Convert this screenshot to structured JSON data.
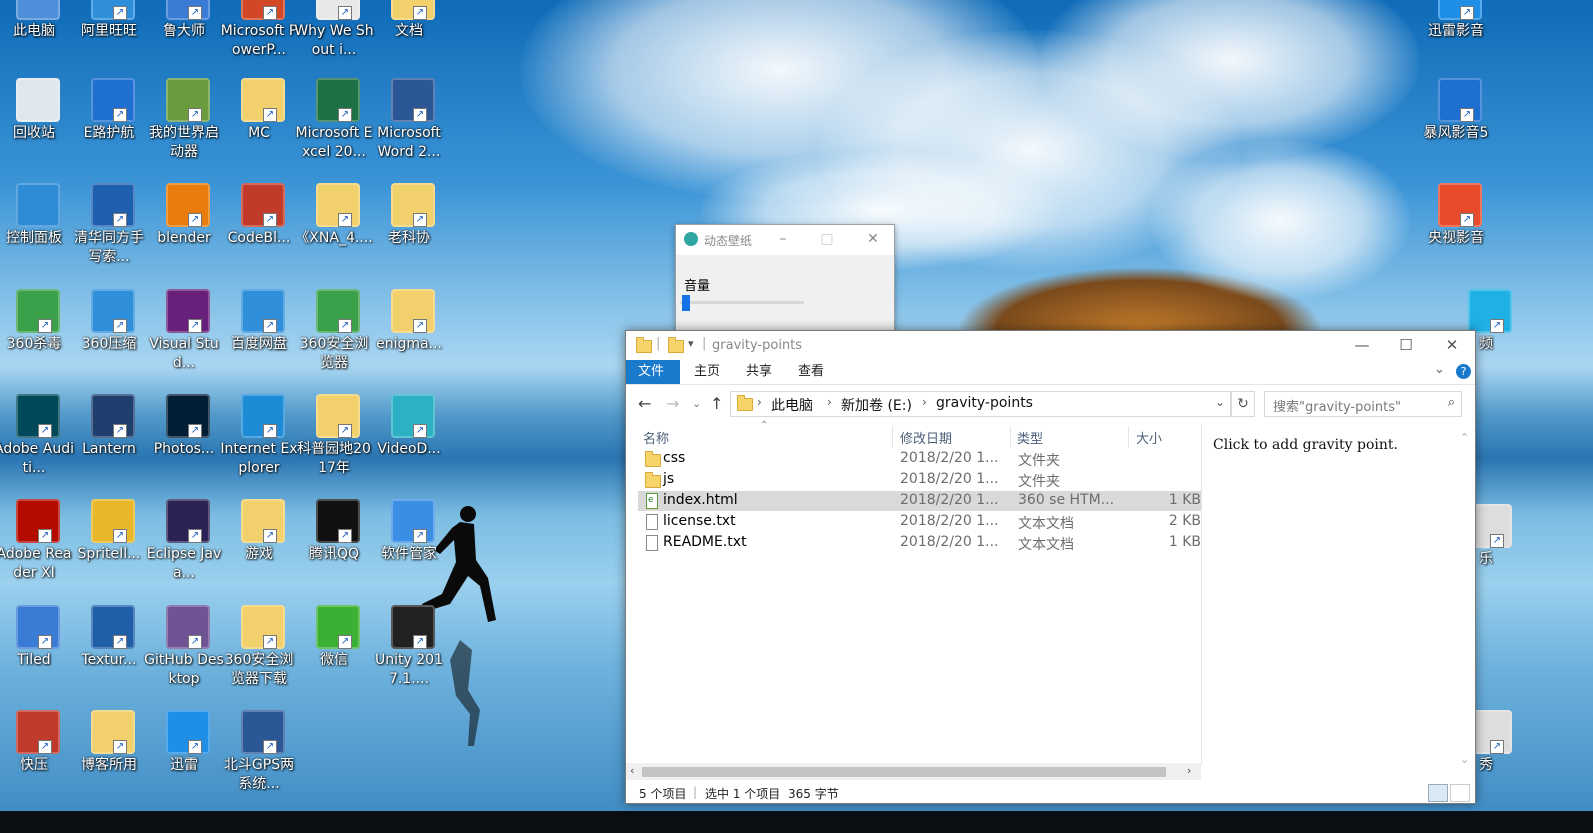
{
  "desktop": {
    "icons": [
      {
        "label": "此电脑",
        "color": "#4f8fd9"
      },
      {
        "label": "阿里旺旺",
        "color": "#2f8fdb"
      },
      {
        "label": "鲁大师",
        "color": "#3a7bd5"
      },
      {
        "label": "Microsoft PowerP...",
        "color": "#d24726"
      },
      {
        "label": "Why We Shout i...",
        "color": "#e8e8e8"
      },
      {
        "label": "文档",
        "color": "#f2d06b"
      },
      {
        "label": "回收站",
        "color": "#dfe8ef"
      },
      {
        "label": "E路护航",
        "color": "#1f6fd1"
      },
      {
        "label": "我的世界启动器",
        "color": "#6a9b3c"
      },
      {
        "label": "MC",
        "color": "#f2d06b"
      },
      {
        "label": "Microsoft Excel 20...",
        "color": "#1d7145"
      },
      {
        "label": "Microsoft Word 2...",
        "color": "#2b5797"
      },
      {
        "label": "控制面板",
        "color": "#2e8bd6"
      },
      {
        "label": "清华同方手写索...",
        "color": "#1f5fb0"
      },
      {
        "label": "blender",
        "color": "#e87d0d"
      },
      {
        "label": "CodeBl...",
        "color": "#c23b2a"
      },
      {
        "label": "《XNA_4....",
        "color": "#f2d06b"
      },
      {
        "label": "老科协",
        "color": "#f2d06b"
      },
      {
        "label": "360杀毒",
        "color": "#3aa04a"
      },
      {
        "label": "360压缩",
        "color": "#2f8fdb"
      },
      {
        "label": "Visual Stud...",
        "color": "#68217a"
      },
      {
        "label": "百度网盘",
        "color": "#2f8fdb"
      },
      {
        "label": "360安全浏览器",
        "color": "#3aa04a"
      },
      {
        "label": "enigma...",
        "color": "#f2d06b"
      },
      {
        "label": "Adobe Auditi...",
        "color": "#00495a"
      },
      {
        "label": "Lantern",
        "color": "#1f3f6f"
      },
      {
        "label": "Photos...",
        "color": "#001e36"
      },
      {
        "label": "Internet Explorer",
        "color": "#1e8bd6"
      },
      {
        "label": "科普园地2017年",
        "color": "#f2d06b"
      },
      {
        "label": "VideoD...",
        "color": "#2bb0c4"
      },
      {
        "label": "Adobe Reader XI",
        "color": "#b30b00"
      },
      {
        "label": "SpriteIl...",
        "color": "#e8b82a"
      },
      {
        "label": "Eclipse Java...",
        "color": "#2c2255"
      },
      {
        "label": "游戏",
        "color": "#f2d06b"
      },
      {
        "label": "腾讯QQ",
        "color": "#111111"
      },
      {
        "label": "软件管家",
        "color": "#3a8ee6"
      },
      {
        "label": "Tiled",
        "color": "#3a7bd5"
      },
      {
        "label": "Textur...",
        "color": "#1f5fa8"
      },
      {
        "label": "GitHub Desktop",
        "color": "#6e5494"
      },
      {
        "label": "360安全浏览器下载",
        "color": "#f2d06b"
      },
      {
        "label": "微信",
        "color": "#3cb034"
      },
      {
        "label": "Unity 2017.1....",
        "color": "#222222"
      },
      {
        "label": "快压",
        "color": "#c0392b"
      },
      {
        "label": "博客所用",
        "color": "#f2d06b"
      },
      {
        "label": "迅雷",
        "color": "#1f8ee6"
      },
      {
        "label": "北斗GPS两系统...",
        "color": "#2b5797"
      },
      {
        "label": "迅雷影音",
        "color": "#1f8ee6"
      },
      {
        "label": "暴风影音5",
        "color": "#1f6fd1"
      },
      {
        "label": "央视影音",
        "color": "#e84b2a"
      },
      {
        "label": "频",
        "color": "#1fb0e6"
      },
      {
        "label": "乐",
        "color": "#dddddd"
      },
      {
        "label": "秀",
        "color": "#dddddd"
      }
    ]
  },
  "wallpaper_app": {
    "title": "动态壁纸",
    "volume_label": "音量",
    "volume_level": 0.05
  },
  "explorer": {
    "title": "gravity-points",
    "ribbon_tabs": [
      "文件",
      "主页",
      "共享",
      "查看"
    ],
    "help": "?",
    "address": [
      "此电脑",
      "新加卷 (E:)",
      "gravity-points"
    ],
    "search_placeholder": "搜索\"gravity-points\"",
    "columns": [
      "名称",
      "修改日期",
      "类型",
      "大小"
    ],
    "files": [
      {
        "name": "css",
        "date": "2018/2/20 1...",
        "type": "文件夹",
        "size": "",
        "kind": "folder"
      },
      {
        "name": "js",
        "date": "2018/2/20 1...",
        "type": "文件夹",
        "size": "",
        "kind": "folder"
      },
      {
        "name": "index.html",
        "date": "2018/2/20 1...",
        "type": "360 se HTM...",
        "size": "1 KB",
        "kind": "html",
        "selected": true
      },
      {
        "name": "license.txt",
        "date": "2018/2/20 1...",
        "type": "文本文档",
        "size": "2 KB",
        "kind": "txt"
      },
      {
        "name": "README.txt",
        "date": "2018/2/20 1...",
        "type": "文本文档",
        "size": "1 KB",
        "kind": "txt"
      }
    ],
    "preview_text": "Click to add gravity point.",
    "status": {
      "item_count": "5 个项目",
      "selection": "选中 1 个项目",
      "size": "365 字节"
    }
  }
}
